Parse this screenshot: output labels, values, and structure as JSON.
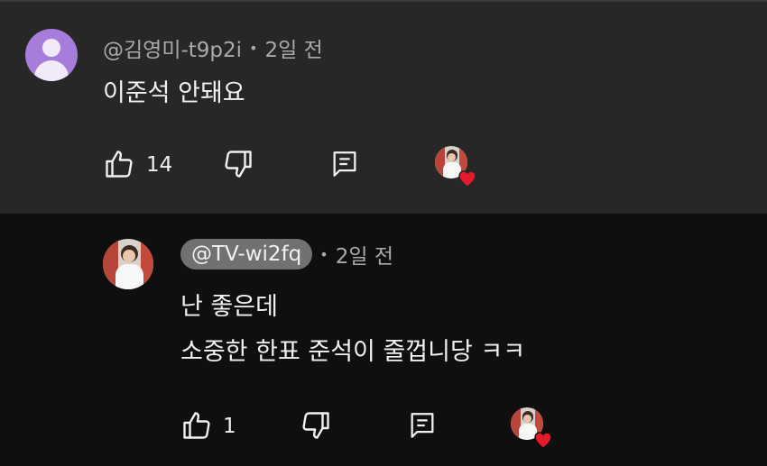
{
  "comment": {
    "author": "@김영미-t9p2i",
    "separator": "•",
    "time": "2일 전",
    "text": "이준석  안돼요",
    "like_count": "14"
  },
  "reply": {
    "author": "@TV-wi2fq",
    "separator": "•",
    "time": "2일 전",
    "text_line1": "난 좋은데",
    "text_line2": "소중한 한표 준석이 줄껍니당 ㅋㅋ",
    "like_count": "1"
  },
  "colors": {
    "main_bg": "#272727",
    "reply_bg": "#0f0f0f",
    "avatar_purple": "#a67ddb",
    "heart_red": "#e6192b",
    "text_primary": "#f1f1f1",
    "text_secondary": "#aaaaaa"
  },
  "icons": {
    "like": "thumb-up-icon",
    "dislike": "thumb-down-icon",
    "reply": "comment-icon",
    "heart": "heart-icon"
  }
}
